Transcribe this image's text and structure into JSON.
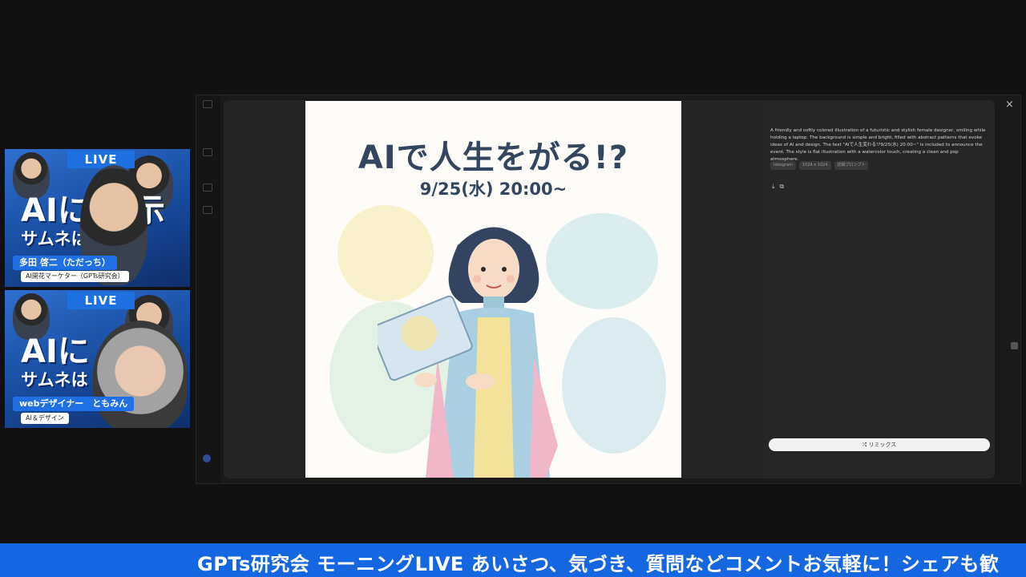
{
  "participants": [
    {
      "live": "LIVE",
      "title_big": "AIに 指示",
      "title_sub": "サムネは なる?",
      "name": "多田 啓二（ただっち）",
      "role": "AI開花マーケター（GPTs研究会）"
    },
    {
      "live": "LIVE",
      "title_big": "AIに",
      "title_sub": "サムネは",
      "name": "webデザイナー　ともみん",
      "role": "AI＆デザイン"
    }
  ],
  "artwork": {
    "title": "AIで人生をがる!?",
    "date": "9/25(水) 20:00~"
  },
  "details": {
    "description": "A friendly and softly colored illustration of a futuristic and stylish female designer, smiling while holding a laptop. The background is simple and bright, filled with abstract patterns that evoke ideas of AI and design. The text \"AIで人生変わる!?9/25(水) 20:00~\" is included to announce the event. The style is flat illustration with a watercolor touch, creating a clean and pop atmosphere.",
    "chips": [
      "Ideogram",
      "1024 x 1024",
      "詳細プロンプト"
    ],
    "remix_label": "リミックス",
    "close_icon": "×"
  },
  "ticker": {
    "text": "GPTs研究会 モーニングLIVE あいさつ、気づき、質問などコメントお気軽に！シェアも歓"
  },
  "colors": {
    "ticker_bg": "#1467e0",
    "artwork_text": "#33465e",
    "name_tag": "#1f6fe5"
  }
}
